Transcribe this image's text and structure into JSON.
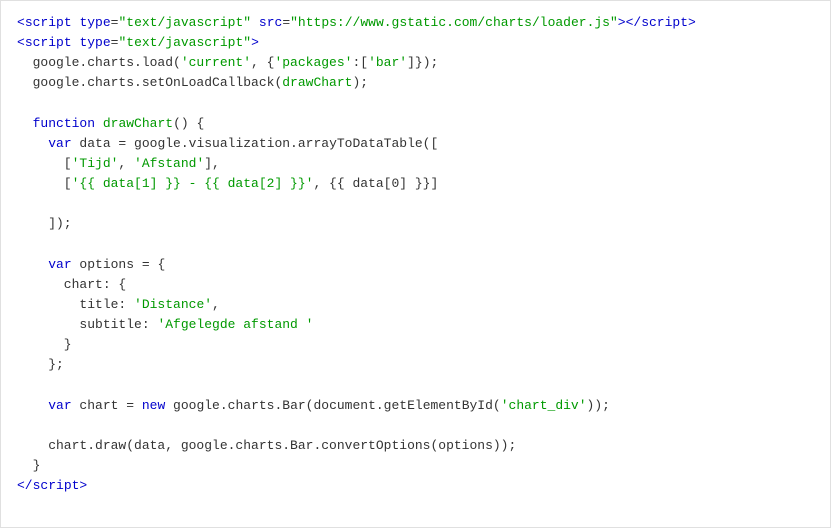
{
  "code": {
    "lines": [
      {
        "id": "l1",
        "parts": [
          {
            "text": "<",
            "cls": "c-tag"
          },
          {
            "text": "script",
            "cls": "c-attr"
          },
          {
            "text": " ",
            "cls": "c-default"
          },
          {
            "text": "type",
            "cls": "c-attr"
          },
          {
            "text": "=",
            "cls": "c-default"
          },
          {
            "text": "\"text/javascript\"",
            "cls": "c-attr-val"
          },
          {
            "text": " ",
            "cls": "c-default"
          },
          {
            "text": "src",
            "cls": "c-attr"
          },
          {
            "text": "=",
            "cls": "c-default"
          },
          {
            "text": "\"https://www.gstatic.com/charts/loader.js\"",
            "cls": "c-attr-val"
          },
          {
            "text": ">",
            "cls": "c-tag"
          },
          {
            "text": "</",
            "cls": "c-tag"
          },
          {
            "text": "script",
            "cls": "c-attr"
          },
          {
            "text": ">",
            "cls": "c-tag"
          }
        ]
      },
      {
        "id": "l2",
        "parts": [
          {
            "text": "<",
            "cls": "c-tag"
          },
          {
            "text": "script",
            "cls": "c-attr"
          },
          {
            "text": " ",
            "cls": "c-default"
          },
          {
            "text": "type",
            "cls": "c-attr"
          },
          {
            "text": "=",
            "cls": "c-default"
          },
          {
            "text": "\"text/javascript\"",
            "cls": "c-attr-val"
          },
          {
            "text": ">",
            "cls": "c-tag"
          }
        ]
      },
      {
        "id": "l3",
        "parts": [
          {
            "text": "  google.charts.load(",
            "cls": "c-default"
          },
          {
            "text": "'current'",
            "cls": "c-string"
          },
          {
            "text": ", {",
            "cls": "c-default"
          },
          {
            "text": "'packages'",
            "cls": "c-string"
          },
          {
            "text": ":[",
            "cls": "c-default"
          },
          {
            "text": "'bar'",
            "cls": "c-string"
          },
          {
            "text": "]});",
            "cls": "c-default"
          }
        ]
      },
      {
        "id": "l4",
        "parts": [
          {
            "text": "  google.charts.setOnLoadCallback(",
            "cls": "c-default"
          },
          {
            "text": "drawChart",
            "cls": "c-funcname"
          },
          {
            "text": ");",
            "cls": "c-default"
          }
        ]
      },
      {
        "id": "l5",
        "parts": [
          {
            "text": "",
            "cls": "c-default"
          }
        ]
      },
      {
        "id": "l6",
        "parts": [
          {
            "text": "  ",
            "cls": "c-default"
          },
          {
            "text": "function",
            "cls": "c-keyword"
          },
          {
            "text": " ",
            "cls": "c-default"
          },
          {
            "text": "drawChart",
            "cls": "c-funcname"
          },
          {
            "text": "() {",
            "cls": "c-default"
          }
        ]
      },
      {
        "id": "l7",
        "parts": [
          {
            "text": "    ",
            "cls": "c-default"
          },
          {
            "text": "var",
            "cls": "c-keyword"
          },
          {
            "text": " data = google.visualization.arrayToDataTable([",
            "cls": "c-default"
          }
        ]
      },
      {
        "id": "l8",
        "parts": [
          {
            "text": "      [",
            "cls": "c-default"
          },
          {
            "text": "'Tijd'",
            "cls": "c-string"
          },
          {
            "text": ", ",
            "cls": "c-default"
          },
          {
            "text": "'Afstand'",
            "cls": "c-string"
          },
          {
            "text": "],",
            "cls": "c-default"
          }
        ]
      },
      {
        "id": "l9",
        "parts": [
          {
            "text": "      [",
            "cls": "c-default"
          },
          {
            "text": "'{{ data[1] }} - {{ data[2] }}'",
            "cls": "c-string"
          },
          {
            "text": ", {{ data[0] }}]",
            "cls": "c-default"
          }
        ]
      },
      {
        "id": "l10",
        "parts": [
          {
            "text": "",
            "cls": "c-default"
          }
        ]
      },
      {
        "id": "l11",
        "parts": [
          {
            "text": "    ]);",
            "cls": "c-default"
          }
        ]
      },
      {
        "id": "l12",
        "parts": [
          {
            "text": "",
            "cls": "c-default"
          }
        ]
      },
      {
        "id": "l13",
        "parts": [
          {
            "text": "    ",
            "cls": "c-default"
          },
          {
            "text": "var",
            "cls": "c-keyword"
          },
          {
            "text": " options = {",
            "cls": "c-default"
          }
        ]
      },
      {
        "id": "l14",
        "parts": [
          {
            "text": "      chart: {",
            "cls": "c-default"
          }
        ]
      },
      {
        "id": "l15",
        "parts": [
          {
            "text": "        title: ",
            "cls": "c-default"
          },
          {
            "text": "'Distance'",
            "cls": "c-string"
          },
          {
            "text": ",",
            "cls": "c-default"
          }
        ]
      },
      {
        "id": "l16",
        "parts": [
          {
            "text": "        subtitle: ",
            "cls": "c-default"
          },
          {
            "text": "'Afgelegde afstand '",
            "cls": "c-string"
          }
        ]
      },
      {
        "id": "l17",
        "parts": [
          {
            "text": "      }",
            "cls": "c-default"
          }
        ]
      },
      {
        "id": "l18",
        "parts": [
          {
            "text": "    };",
            "cls": "c-default"
          }
        ]
      },
      {
        "id": "l19",
        "parts": [
          {
            "text": "",
            "cls": "c-default"
          }
        ]
      },
      {
        "id": "l20",
        "parts": [
          {
            "text": "    ",
            "cls": "c-default"
          },
          {
            "text": "var",
            "cls": "c-keyword"
          },
          {
            "text": " chart = ",
            "cls": "c-default"
          },
          {
            "text": "new",
            "cls": "c-keyword"
          },
          {
            "text": " google.charts.Bar(document.getElementById(",
            "cls": "c-default"
          },
          {
            "text": "'chart_div'",
            "cls": "c-string"
          },
          {
            "text": "));",
            "cls": "c-default"
          }
        ]
      },
      {
        "id": "l21",
        "parts": [
          {
            "text": "",
            "cls": "c-default"
          }
        ]
      },
      {
        "id": "l22",
        "parts": [
          {
            "text": "    chart.draw(data, google.charts.Bar.convertOptions(options));",
            "cls": "c-default"
          }
        ]
      },
      {
        "id": "l23",
        "parts": [
          {
            "text": "  }",
            "cls": "c-default"
          }
        ]
      },
      {
        "id": "l24",
        "parts": [
          {
            "text": "</",
            "cls": "c-tag"
          },
          {
            "text": "script",
            "cls": "c-attr"
          },
          {
            "text": ">",
            "cls": "c-tag"
          }
        ]
      }
    ]
  }
}
